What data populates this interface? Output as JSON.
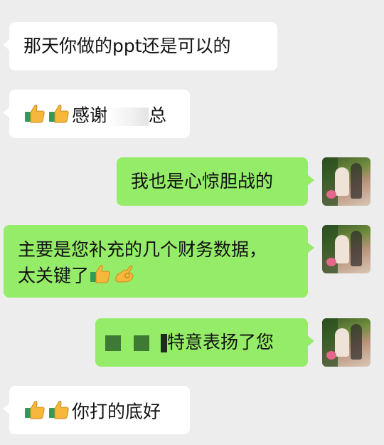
{
  "messages": [
    {
      "side": "in",
      "text": "那天你做的ppt还是可以的"
    },
    {
      "side": "in",
      "pre_emoji": [
        "thumbs-up",
        "thumbs-up"
      ],
      "text_a": "感谢",
      "text_b": "总",
      "redacted": true
    },
    {
      "side": "out",
      "text": "我也是心惊胆战的"
    },
    {
      "side": "out",
      "line1": "主要是您补充的几个财务数据，",
      "line2": "太关键了",
      "post_emoji": [
        "thumbs-up",
        "ok-hand"
      ]
    },
    {
      "side": "out",
      "text": "特意表扬了您",
      "redacted": true
    },
    {
      "side": "in",
      "pre_emoji": [
        "thumbs-up",
        "thumbs-up"
      ],
      "text": "你打的底好"
    }
  ],
  "colors": {
    "background": "#ededed",
    "incoming_bubble": "#ffffff",
    "outgoing_bubble": "#95ec69"
  }
}
